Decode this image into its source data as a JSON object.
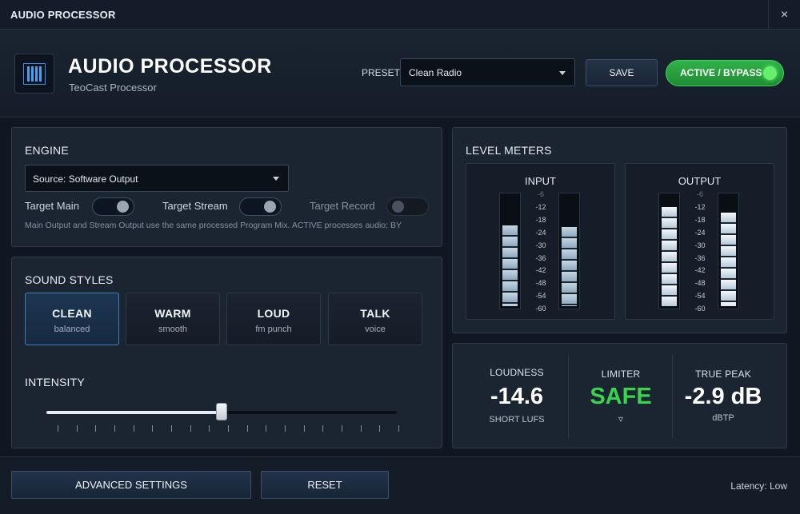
{
  "window": {
    "title": "AUDIO PROCESSOR",
    "close_glyph": "×"
  },
  "header": {
    "logo_icon": "equalizer-bars-icon",
    "title": "AUDIO PROCESSOR",
    "subtitle": "TeoCast Processor",
    "preset_label": "PRESET",
    "preset_value": "Clean Radio",
    "save_label": "SAVE",
    "active_label": "ACTIVE / BYPASS"
  },
  "engine": {
    "title": "ENGINE",
    "source_value": "Source:  Software Output",
    "toggles": [
      {
        "label": "Target Main",
        "on": true
      },
      {
        "label": "Target Stream",
        "on": true
      },
      {
        "label": "Target Record",
        "on": false
      }
    ],
    "note": "Main Output and Stream Output use the same processed Program Mix. ACTIVE processes audio; BY"
  },
  "sound_styles": {
    "title": "SOUND STYLES",
    "styles": [
      {
        "name": "CLEAN",
        "sub": "balanced",
        "selected": true
      },
      {
        "name": "WARM",
        "sub": "smooth",
        "selected": false
      },
      {
        "name": "LOUD",
        "sub": "fm punch",
        "selected": false
      },
      {
        "name": "TALK",
        "sub": "voice",
        "selected": false
      }
    ],
    "intensity_label": "INTENSITY",
    "intensity_value": 0.5
  },
  "level_meters": {
    "title": "LEVEL METERS",
    "scale": [
      "-6",
      "-12",
      "-18",
      "-24",
      "-30",
      "-36",
      "-42",
      "-48",
      "-54",
      "-60"
    ],
    "input": {
      "label": "INPUT",
      "levels": [
        0.73,
        0.72
      ]
    },
    "output": {
      "label": "OUTPUT",
      "levels": [
        0.9,
        0.85
      ]
    }
  },
  "stats": {
    "loudness": {
      "label": "LOUDNESS",
      "value": "-14.6",
      "unit": "SHORT LUFS"
    },
    "limiter": {
      "label": "LIMITER",
      "value": "SAFE",
      "glyph": "▿"
    },
    "true_peak": {
      "label": "TRUE PEAK",
      "value": "-2.9 dB",
      "unit": "dBTP"
    }
  },
  "footer": {
    "advanced_label": "ADVANCED SETTINGS",
    "reset_label": "RESET",
    "latency": "Latency: Low"
  },
  "colors": {
    "accent_green": "#3ad34f",
    "selected_blue": "#3f7fc0",
    "background": "#0f1722"
  }
}
